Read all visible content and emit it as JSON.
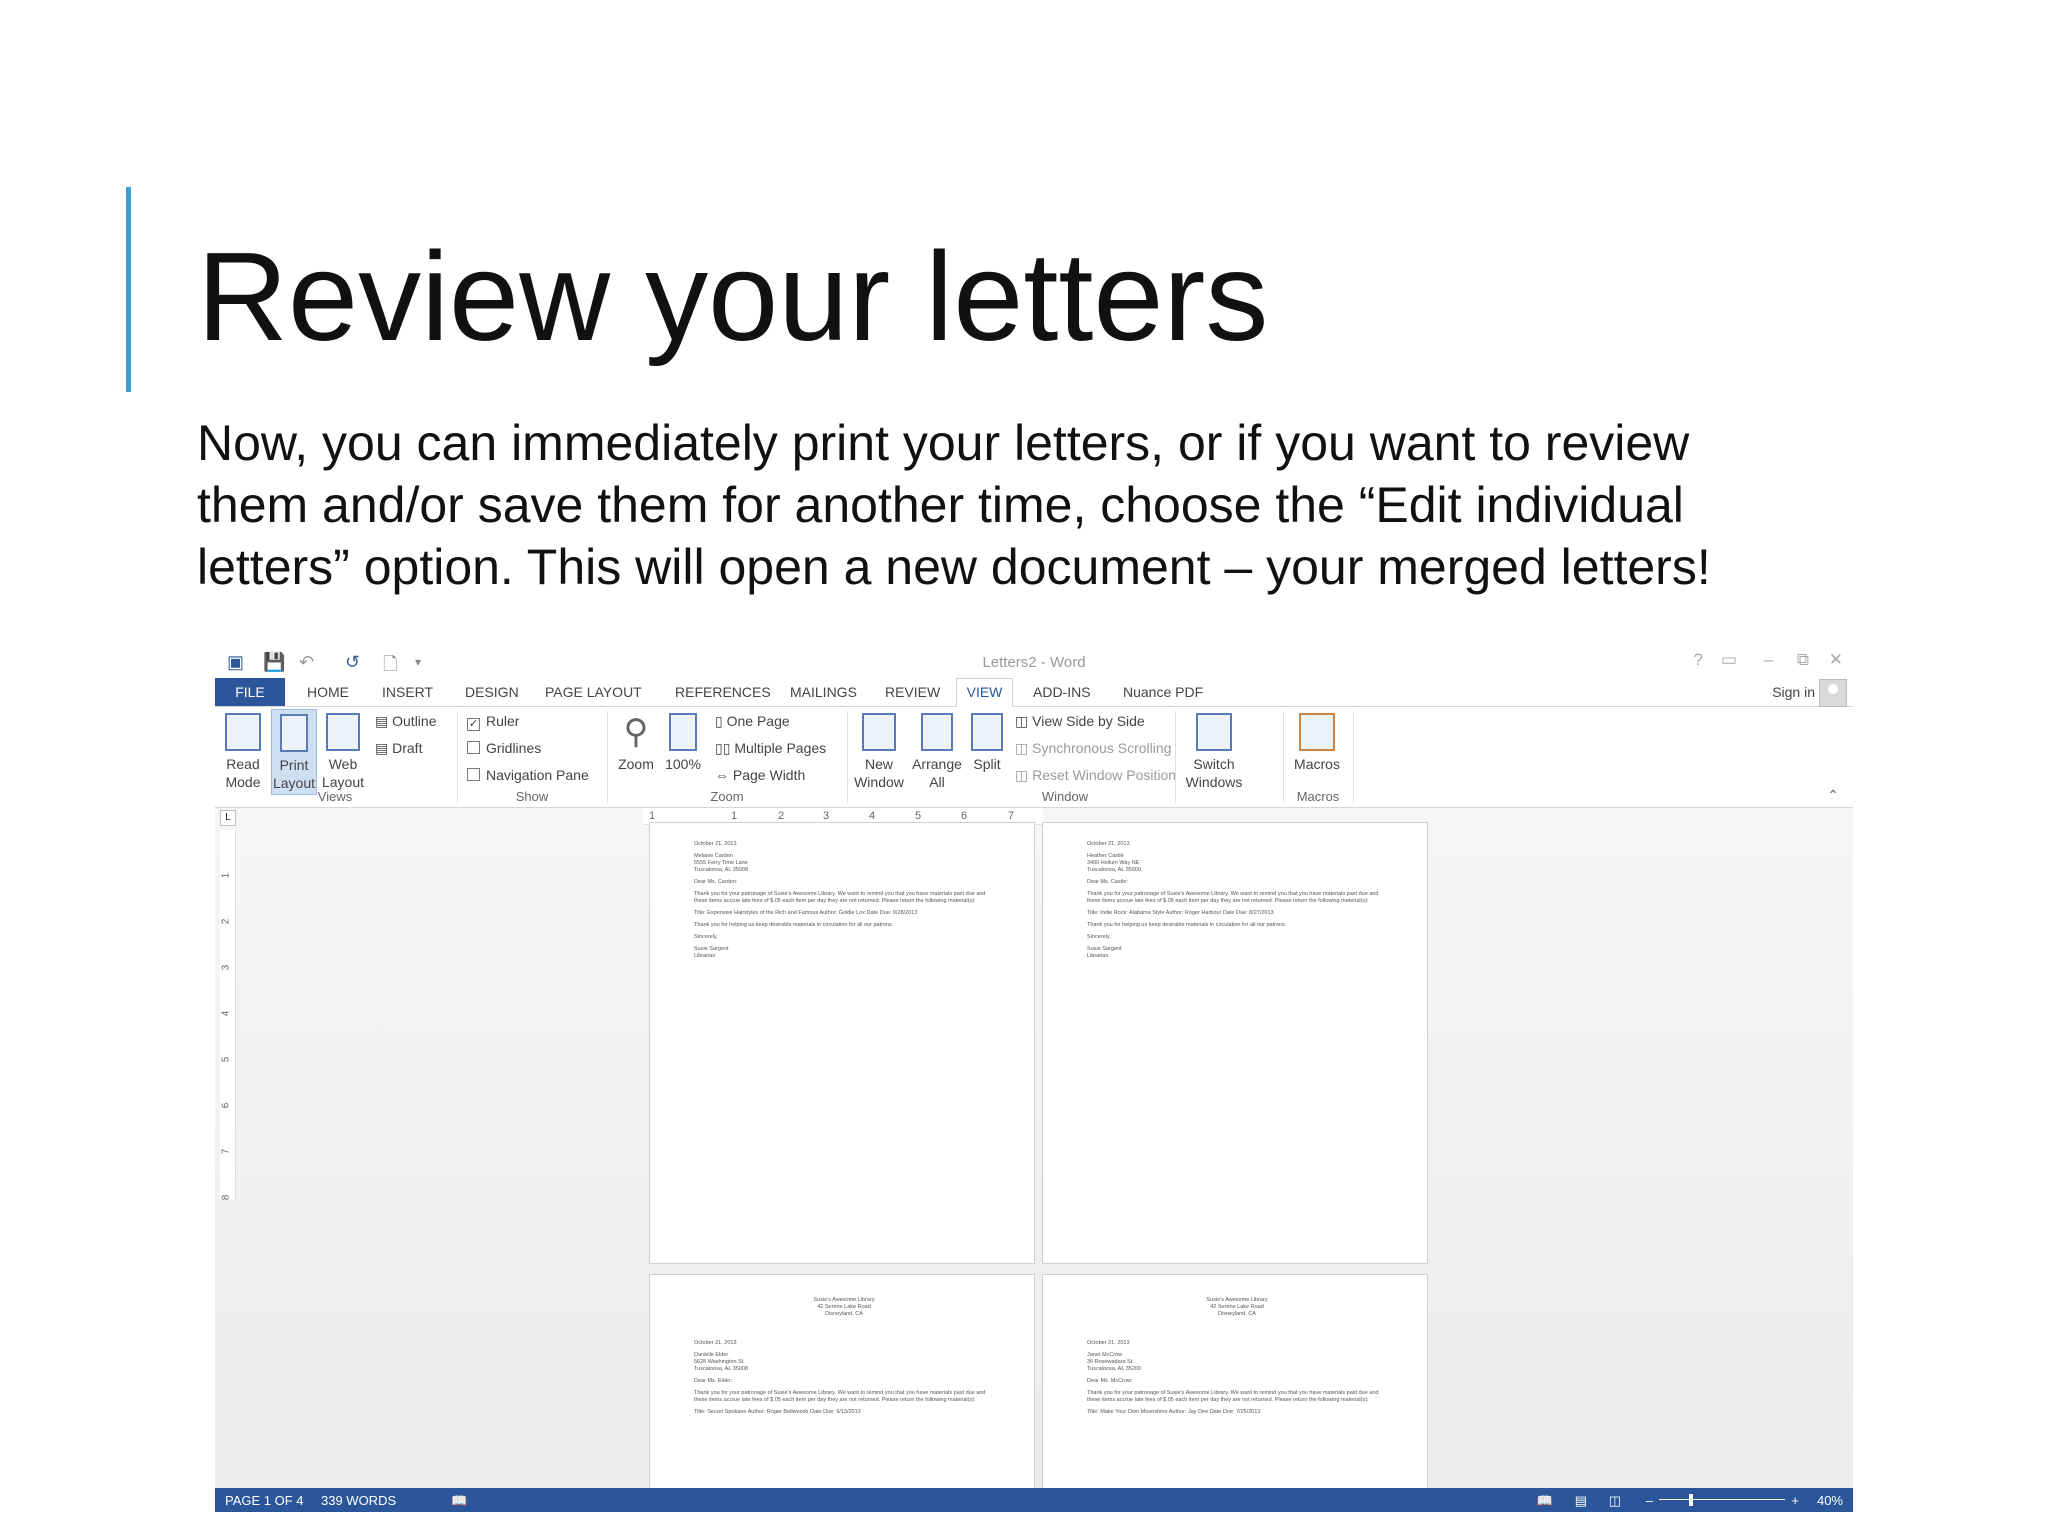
{
  "slide": {
    "title": "Review your letters",
    "body": "Now, you can immediately print your letters, or if you want to review them and/or save them for another time, choose the “Edit individual letters” option. This will open a new document – your merged letters!"
  },
  "word": {
    "window_title": "Letters2 - Word",
    "tabs": [
      "FILE",
      "HOME",
      "INSERT",
      "DESIGN",
      "PAGE LAYOUT",
      "REFERENCES",
      "MAILINGS",
      "REVIEW",
      "VIEW",
      "ADD-INS",
      "Nuance PDF"
    ],
    "sign_in": "Sign in",
    "ribbon": {
      "views": {
        "group": "Views",
        "read_mode": "Read Mode",
        "print_layout": "Print Layout",
        "web_layout": "Web Layout",
        "outline": "Outline",
        "draft": "Draft"
      },
      "show": {
        "group": "Show",
        "ruler": "Ruler",
        "gridlines": "Gridlines",
        "navigation_pane": "Navigation Pane",
        "ruler_checked": true
      },
      "zoom": {
        "group": "Zoom",
        "zoom": "Zoom",
        "hundred": "100%",
        "one_page": "One Page",
        "multiple_pages": "Multiple Pages",
        "page_width": "Page Width"
      },
      "window": {
        "group": "Window",
        "new_window": "New Window",
        "arrange_all": "Arrange All",
        "split": "Split",
        "side_by_side": "View Side by Side",
        "sync_scroll": "Synchronous Scrolling",
        "reset_pos": "Reset Window Position",
        "switch_windows": "Switch Windows"
      },
      "macros": {
        "group": "Macros",
        "macros": "Macros"
      }
    },
    "ruler": {
      "h_ticks": [
        "1",
        "1",
        "2",
        "3",
        "4",
        "5",
        "6",
        "7"
      ],
      "v_ticks": [
        "1",
        "2",
        "3",
        "4",
        "5",
        "6",
        "7",
        "8"
      ]
    },
    "pages": [
      {
        "date": "October 21, 2013",
        "name": "Melanie Carden",
        "addr1": "5555 Ferry Time Lane",
        "addr2": "Tuscaloosa, AL 35008",
        "salutation": "Dear Ms. Carden:",
        "para": "Thank you for your patronage of Susie's Awesome Library. We want to remind you that you have materials past due and these items accrue late fees of $.05 each item per day they are not returned. Please return the following material(s):",
        "item": "Title: Expensive Hairstyles of the Rich and Famous   Author: Goldie Lox  Date Due: 9/28/2013",
        "thanks": "Thank you for helping us keep desirable materials in circulation for all our patrons.",
        "closing": "Sincerely,",
        "sig1": "Susie Sargent",
        "sig2": "Librarian"
      },
      {
        "date": "October 21, 2013",
        "name": "Heather Castle",
        "addr1": "3400 Hellum Way NE",
        "addr2": "Tuscaloosa, AL 35000",
        "salutation": "Dear Ms. Castle:",
        "para": "Thank you for your patronage of Susie's Awesome Library. We want to remind you that you have materials past due and these items accrue late fees of $.05 each item per day they are not returned. Please return the following material(s):",
        "item": "Title: Indie Rock: Alabama Style   Author: Roger Harbour  Date Due: 8/27/2013",
        "thanks": "Thank you for helping us keep desirable materials in circulation for all our patrons.",
        "closing": "Sincerely,",
        "sig1": "Susie Sargent",
        "sig2": "Librarian"
      },
      {
        "lh1": "Susie's Awesome Library",
        "lh2": "42 Serene Lake Road",
        "lh3": "Disneyland, CA",
        "date": "October 21, 2013",
        "name": "Danielle Elder",
        "addr1": "5628 Washington St.",
        "addr2": "Tuscaloosa, AL 35008",
        "salutation": "Dear Ms. Elder:",
        "para": "Thank you for your patronage of Susie's Awesome Library. We want to remind you that you have materials past due and these items accrue late fees of $.05 each item per day they are not returned. Please return the following material(s):",
        "item": "Title: Secret Spokane   Author: Roger Bellwoods  Date Due: 9/13/2013"
      },
      {
        "lh1": "Susie's Awesome Library",
        "lh2": "42 Serene Lake Road",
        "lh3": "Disneyland, CA",
        "date": "October 21, 2013",
        "name": "Janet McCrow",
        "addr1": "36 Rosewadara St.",
        "addr2": "Tuscaloosa, AL 35200",
        "salutation": "Dear Ms. McCrow:",
        "para": "Thank you for your patronage of Susie's Awesome Library. We want to remind you that you have materials past due and these items accrue late fees of $.05 each item per day they are not returned. Please return the following material(s):",
        "item": "Title: Make Your Own Moonshine   Author: Jay Dee  Date Due: 7/25/2013"
      }
    ],
    "status": {
      "page": "PAGE 1 OF 4",
      "words": "339 WORDS",
      "zoom": "40%"
    }
  }
}
